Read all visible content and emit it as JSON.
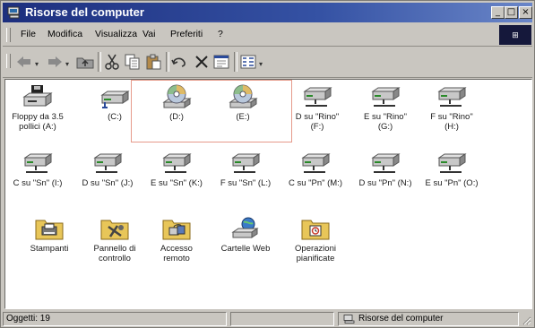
{
  "window": {
    "title": "Risorse del computer",
    "min_glyph": "_",
    "max_glyph": "□",
    "close_glyph": "×"
  },
  "menu": [
    "File",
    "Modifica",
    "Visualizza",
    "Vai",
    "Preferiti",
    "?"
  ],
  "toolbar": {
    "buttons": [
      "back-icon",
      "forward-icon",
      "up-folder-icon",
      "cut-icon",
      "copy-icon",
      "paste-icon",
      "undo-icon",
      "delete-icon",
      "properties-icon",
      "views-icon"
    ]
  },
  "items": [
    {
      "label": "Floppy da 3.5\npollici (A:)",
      "icon": "floppy-drive-icon"
    },
    {
      "label": "(C:)",
      "icon": "hard-disk-icon"
    },
    {
      "label": "(D:)",
      "icon": "cd-drive-icon"
    },
    {
      "label": "(E:)",
      "icon": "cd-drive-icon"
    },
    {
      "label": "D su \"Rino\"\n(F:)",
      "icon": "network-drive-icon"
    },
    {
      "label": "E su \"Rino\"\n(G:)",
      "icon": "network-drive-icon"
    },
    {
      "label": "F su \"Rino\"\n(H:)",
      "icon": "network-drive-icon"
    },
    {
      "label": "C su \"Sn\" (I:)",
      "icon": "network-drive-icon"
    },
    {
      "label": "D su \"Sn\" (J:)",
      "icon": "network-drive-icon"
    },
    {
      "label": "E su \"Sn\" (K:)",
      "icon": "network-drive-icon"
    },
    {
      "label": "F su \"Sn\" (L:)",
      "icon": "network-drive-icon"
    },
    {
      "label": "C su \"Pn\" (M:)",
      "icon": "network-drive-icon"
    },
    {
      "label": "D su \"Pn\" (N:)",
      "icon": "network-drive-icon"
    },
    {
      "label": "E su \"Pn\" (O:)",
      "icon": "network-drive-icon"
    },
    {
      "label": "Stampanti",
      "icon": "printers-folder-icon"
    },
    {
      "label": "Pannello di\ncontrollo",
      "icon": "control-panel-icon"
    },
    {
      "label": "Accesso\nremoto",
      "icon": "remote-access-icon"
    },
    {
      "label": "Cartelle Web",
      "icon": "web-folders-icon"
    },
    {
      "label": "Operazioni\npianificate",
      "icon": "scheduled-tasks-icon"
    }
  ],
  "status": {
    "objects": "Oggetti: 19",
    "location": "Risorse del computer"
  },
  "colors": {
    "title_start": "#1d2f7e",
    "title_end": "#6a86c8",
    "folder": "#e8c659",
    "highlight": "#e69a8a"
  }
}
